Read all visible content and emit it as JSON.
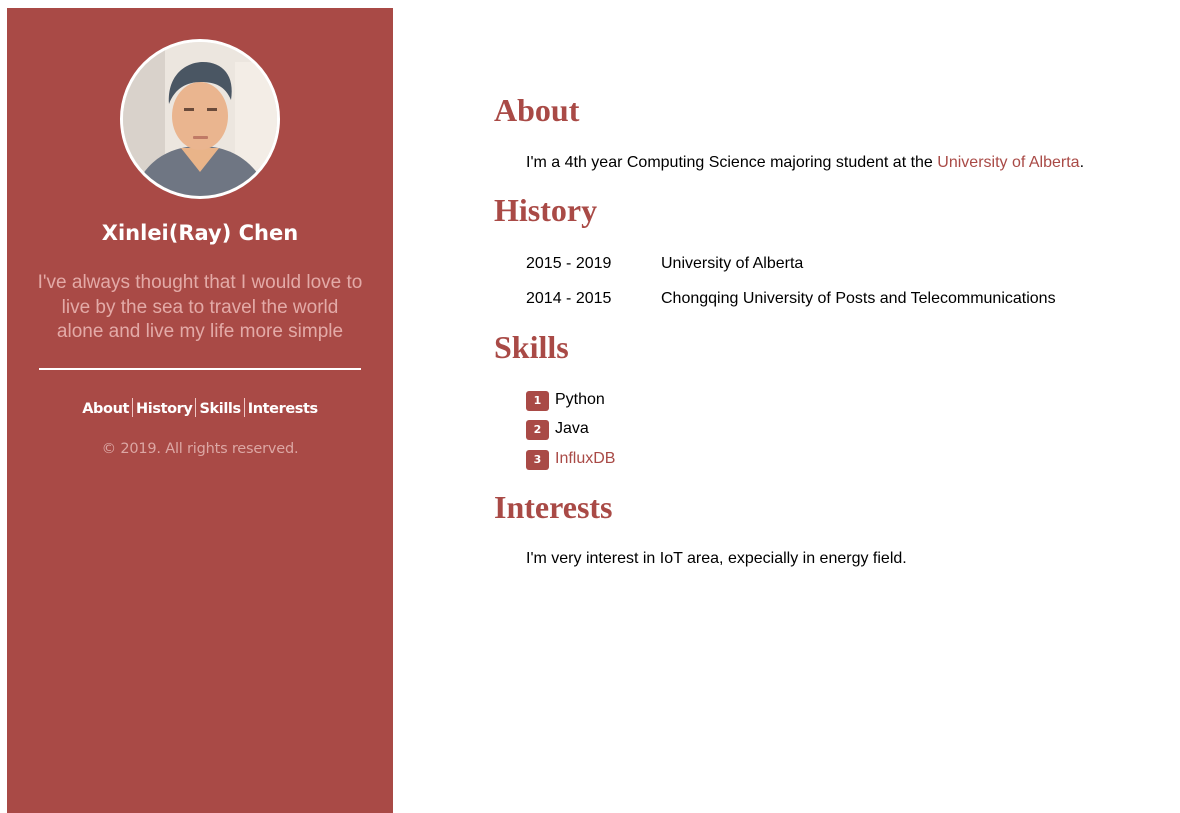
{
  "profile": {
    "name": "Xinlei(Ray) Chen",
    "bio": "I've always thought that I would love to live by the sea to travel the world alone and live my life more simple"
  },
  "nav": {
    "items": [
      "About",
      "History",
      "Skills",
      "Interests"
    ]
  },
  "footer": {
    "copyright": "© 2019. All rights reserved."
  },
  "about": {
    "heading": "About",
    "text_before": "I'm a 4th year Computing Science majoring student at the ",
    "link": "University of Alberta",
    "text_after": "."
  },
  "history": {
    "heading": "History",
    "entries": [
      {
        "period": "2015 - 2019",
        "place": "University of Alberta"
      },
      {
        "period": "2014 - 2015",
        "place": "Chongqing University of Posts and Telecommunications"
      }
    ]
  },
  "skills": {
    "heading": "Skills",
    "items": [
      {
        "rank": "1",
        "name": "Python"
      },
      {
        "rank": "2",
        "name": "Java"
      },
      {
        "rank": "3",
        "name": "InfluxDB"
      }
    ]
  },
  "interests": {
    "heading": "Interests",
    "text": "I'm very interest in IoT area, expecially in energy field."
  },
  "colors": {
    "accent": "#a94a46",
    "sidebar_bg": "#a94a46",
    "bio_text": "#e3aaa7",
    "copyright_text": "#dca7a4"
  },
  "icons": {
    "avatar": "profile-photo"
  }
}
